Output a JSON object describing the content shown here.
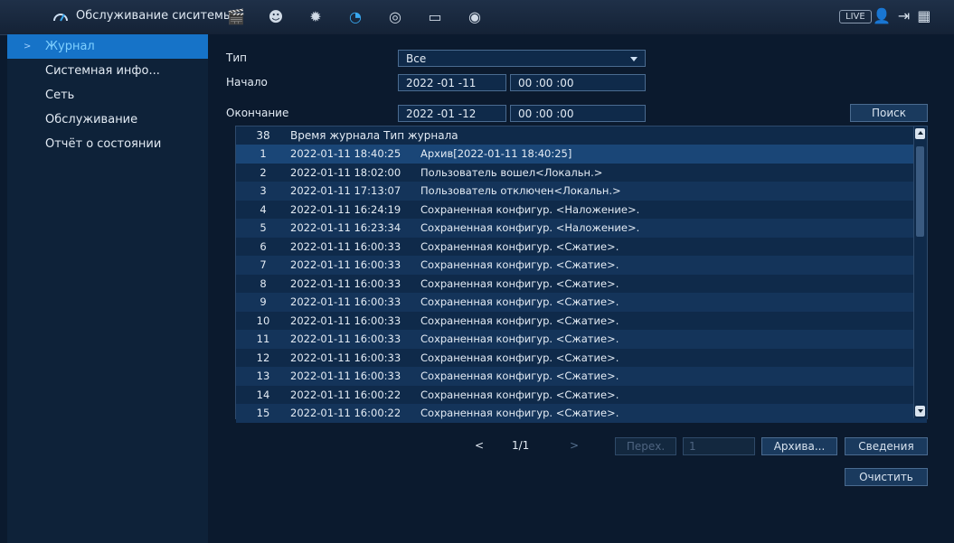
{
  "topbar": {
    "title": "Обслуживание сиситемы",
    "icons": [
      "film-icon",
      "face-icon",
      "bulb-icon",
      "gauge-icon",
      "disc-icon",
      "monitor-icon",
      "speaker-icon"
    ],
    "live": "LIVE",
    "right_icons": [
      "user-icon",
      "logout-icon",
      "qr-icon"
    ]
  },
  "sidebar": {
    "items": [
      {
        "label": "Журнал",
        "active": true
      },
      {
        "label": "Системная инфо..."
      },
      {
        "label": "Сеть"
      },
      {
        "label": "Обслуживание"
      },
      {
        "label": "Отчёт о состоянии"
      }
    ]
  },
  "form": {
    "type_label": "Тип",
    "type_value": "Все",
    "start_label": "Начало",
    "start_date": "2022 -01 -11",
    "start_time": "00 :00 :00",
    "end_label": "Окончание",
    "end_date": "2022 -01 -12",
    "end_time": "00 :00 :00",
    "search_label": "Поиск"
  },
  "table": {
    "count": "38",
    "col_time": "Время журнала",
    "col_type": "Тип журнала",
    "rows": [
      {
        "n": "1",
        "time": "2022-01-11 18:40:25",
        "type": "Архив[2022-01-11 18:40:25]"
      },
      {
        "n": "2",
        "time": "2022-01-11 18:02:00",
        "type": "Пользователь вошел<Локальн.>"
      },
      {
        "n": "3",
        "time": "2022-01-11 17:13:07",
        "type": "Пользователь отключен<Локальн.>"
      },
      {
        "n": "4",
        "time": "2022-01-11 16:24:19",
        "type": "Сохраненная конфигур. <Наложение>."
      },
      {
        "n": "5",
        "time": "2022-01-11 16:23:34",
        "type": "Сохраненная конфигур. <Наложение>."
      },
      {
        "n": "6",
        "time": "2022-01-11 16:00:33",
        "type": "Сохраненная конфигур. <Сжатие>."
      },
      {
        "n": "7",
        "time": "2022-01-11 16:00:33",
        "type": "Сохраненная конфигур. <Сжатие>."
      },
      {
        "n": "8",
        "time": "2022-01-11 16:00:33",
        "type": "Сохраненная конфигур. <Сжатие>."
      },
      {
        "n": "9",
        "time": "2022-01-11 16:00:33",
        "type": "Сохраненная конфигур. <Сжатие>."
      },
      {
        "n": "10",
        "time": "2022-01-11 16:00:33",
        "type": "Сохраненная конфигур. <Сжатие>."
      },
      {
        "n": "11",
        "time": "2022-01-11 16:00:33",
        "type": "Сохраненная конфигур. <Сжатие>."
      },
      {
        "n": "12",
        "time": "2022-01-11 16:00:33",
        "type": "Сохраненная конфигур. <Сжатие>."
      },
      {
        "n": "13",
        "time": "2022-01-11 16:00:33",
        "type": "Сохраненная конфигур. <Сжатие>."
      },
      {
        "n": "14",
        "time": "2022-01-11 16:00:22",
        "type": "Сохраненная конфигур. <Сжатие>."
      },
      {
        "n": "15",
        "time": "2022-01-11 16:00:22",
        "type": "Сохраненная конфигур. <Сжатие>."
      }
    ]
  },
  "pager": {
    "prev": "<",
    "page": "1/1",
    "next": ">",
    "goto_label": "Перех.",
    "goto_value": "1",
    "archive_label": "Архива...",
    "details_label": "Сведения",
    "clear_label": "Очистить"
  }
}
